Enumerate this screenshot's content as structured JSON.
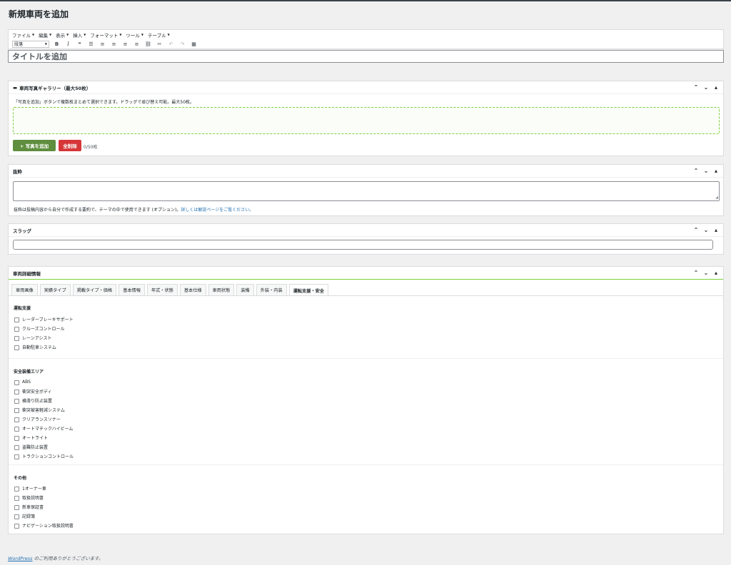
{
  "page": {
    "title": "新規車両を追加"
  },
  "editor": {
    "menu": [
      "ファイル",
      "編集",
      "表示",
      "挿入",
      "フォーマット",
      "ツール",
      "テーブル"
    ],
    "format_select": "段落",
    "title_placeholder": "タイトルを追加"
  },
  "gallery": {
    "title": "車両写真ギャラリー（最大50枚）",
    "description": "「写真を追加」ボタンで複数枚まとめて選択できます。ドラッグで並び替え可能。最大50枚。",
    "add_button": "+ 写真を追加",
    "clear_button": "全削除",
    "count": "0/50枚"
  },
  "excerpt": {
    "title": "抜粋",
    "help_text": "抜粋は投稿内容から自分で作成する要約で、テーマの中で使用できます (オプション)。",
    "help_link": "詳しくは解説ページをご覧ください。"
  },
  "slug": {
    "title": "スラッグ"
  },
  "details": {
    "title": "車両詳細情報",
    "tabs": [
      "車両画像",
      "実績タイプ",
      "掲載タイプ・価格",
      "基本情報",
      "年式・状態",
      "基本仕様",
      "車両状態",
      "装備",
      "外装・内装",
      "運転支援・安全"
    ],
    "active_tab": 9,
    "groups": [
      {
        "title": "運転支援",
        "items": [
          "レーダーブレーキサポート",
          "クルーズコントロール",
          "レーンアシスト",
          "自動駐車システム"
        ]
      },
      {
        "title": "安全装備エリア",
        "items": [
          "ABS",
          "衝突安全ボディ",
          "横滑り防止装置",
          "衝突被害軽減システム",
          "クリアランスソナー",
          "オートマチックハイビーム",
          "オートライト",
          "盗難防止装置",
          "トラクションコントロール"
        ]
      },
      {
        "title": "その他",
        "items": [
          "1オーナー車",
          "取扱説明書",
          "新車保証書",
          "記録簿",
          "ナビゲーション取扱説明書"
        ]
      }
    ]
  },
  "footer": {
    "link": "WordPress",
    "text": " のご利用ありがとうございます。"
  },
  "icons": {
    "gallery": "camera-icon",
    "move_up": "chevron-up-icon",
    "move_down": "chevron-down-icon",
    "toggle": "triangle-icon"
  }
}
